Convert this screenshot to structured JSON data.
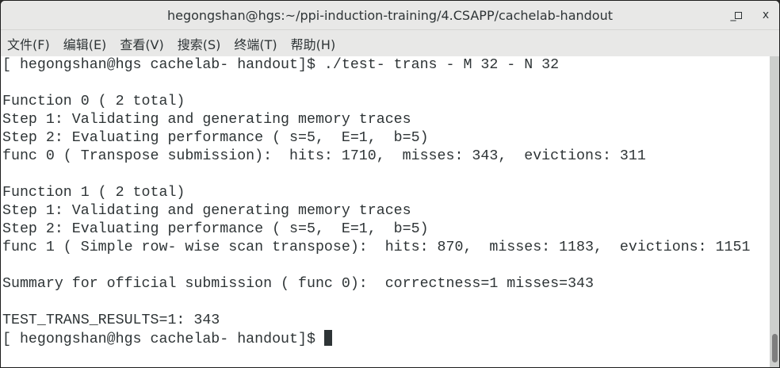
{
  "window": {
    "title": "hegongshan@hgs:~/ppi-induction-training/4.CSAPP/cachelab-handout",
    "minimize": "_",
    "maximize": "▫",
    "close": "x"
  },
  "menu": [
    "文件(F)",
    "编辑(E)",
    "查看(V)",
    "搜索(S)",
    "终端(T)",
    "帮助(H)"
  ],
  "terminal": {
    "lines": [
      "[ hegongshan@hgs cachelab- handout]$ ./test- trans - M 32 - N 32",
      "",
      "Function 0 ( 2 total)",
      "Step 1: Validating and generating memory traces",
      "Step 2: Evaluating performance ( s=5,  E=1,  b=5)",
      "func 0 ( Transpose submission):  hits: 1710,  misses: 343,  evictions: 311",
      "",
      "Function 1 ( 2 total)",
      "Step 1: Validating and generating memory traces",
      "Step 2: Evaluating performance ( s=5,  E=1,  b=5)",
      "func 1 ( Simple row- wise scan transpose):  hits: 870,  misses: 1183,  evictions: 1151",
      "",
      "Summary for official submission ( func 0):  correctness=1 misses=343",
      "",
      "TEST_TRANS_RESULTS=1: 343"
    ],
    "prompt": "[ hegongshan@hgs cachelab- handout]$ "
  }
}
